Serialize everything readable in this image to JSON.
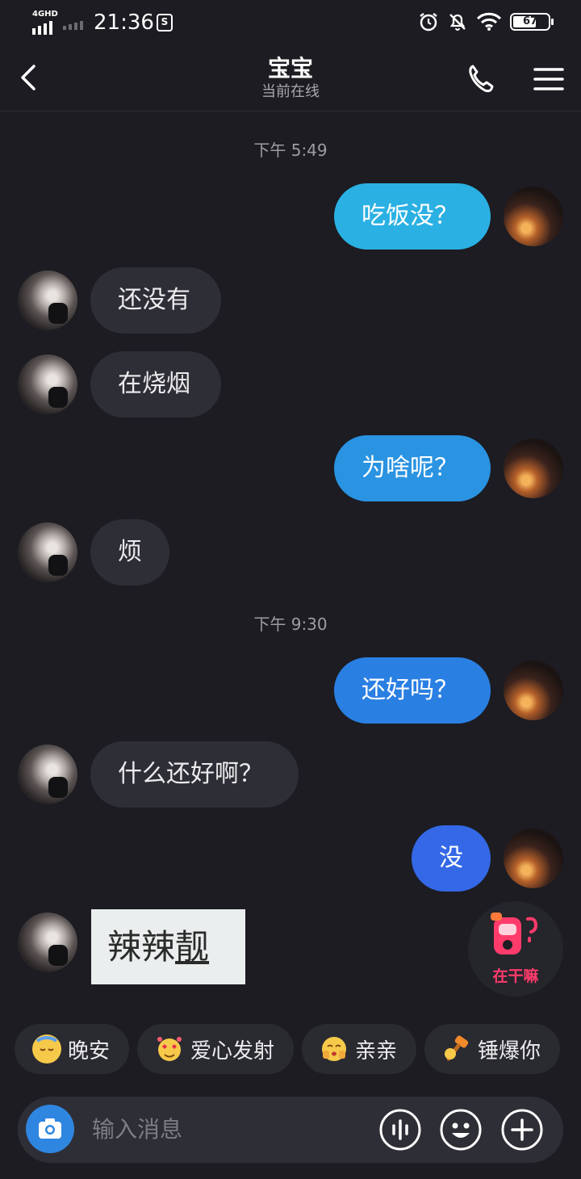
{
  "status_bar": {
    "network": "4GHD",
    "time": "21:36",
    "battery": "67",
    "battery_level": 0.67
  },
  "header": {
    "title": "宝宝",
    "subtitle": "当前在线"
  },
  "messages": {
    "ts1": "下午 5:49",
    "m1": "吃饭没？",
    "m2": "还没有",
    "m3": "在烧烟",
    "m4": "为啥呢？",
    "m5": "烦",
    "ts2": "下午 9:30",
    "m6": "还好吗？",
    "m7": "什么还好啊？",
    "m8": "没",
    "sticker_a": "辣辣",
    "sticker_b": "靓"
  },
  "floating": {
    "label": "在干嘛"
  },
  "quick_replies": [
    {
      "emoji": "sleepy-face-icon",
      "label": "晚安"
    },
    {
      "emoji": "heart-eyes-face-icon",
      "label": "爱心发射"
    },
    {
      "emoji": "kiss-face-icon",
      "label": "亲亲"
    },
    {
      "emoji": "hammer-icon",
      "label": "锤爆你"
    }
  ],
  "input": {
    "placeholder": "输入消息"
  },
  "colors": {
    "bubble_out_1": "#2bb0e3",
    "bubble_out_2": "#2a93e2",
    "bubble_out_3": "#2a7fe3",
    "bubble_out_4": "#3468e6",
    "bubble_in": "#2e2e36",
    "background": "#1c1c22"
  }
}
